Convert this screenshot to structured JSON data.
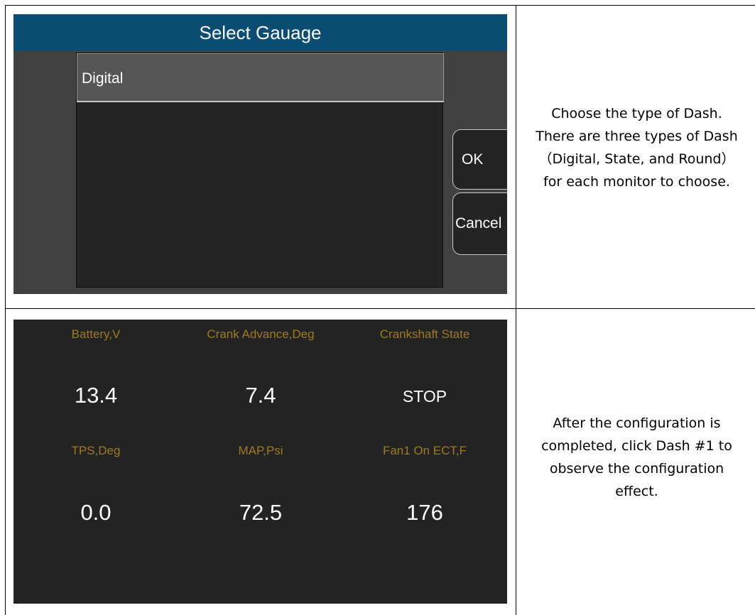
{
  "dialog": {
    "title": "Select Gauage",
    "list_items": [
      "Digital"
    ],
    "ok_label": "OK",
    "cancel_label": "Cancel"
  },
  "descriptions": {
    "top": [
      "Choose the type of Dash.",
      "There are three types of Dash",
      "（Digital, State, and Round）",
      "for each monitor to choose."
    ],
    "bottom": [
      "After the configuration is",
      "completed, click Dash #1 to",
      "observe the configuration",
      "effect."
    ]
  },
  "dash": {
    "gauges": [
      {
        "label": "Battery,V",
        "value": "13.4"
      },
      {
        "label": "Crank Advance,Deg",
        "value": "7.4"
      },
      {
        "label": "Crankshaft State",
        "value": "STOP"
      },
      {
        "label": "TPS,Deg",
        "value": "0.0"
      },
      {
        "label": "MAP,Psi",
        "value": "72.5"
      },
      {
        "label": "Fan1 On ECT,F",
        "value": "176"
      }
    ]
  },
  "colors": {
    "title_bar": "#0b4c72",
    "dialog_bg": "#414141",
    "dash_bg": "#232323",
    "gauge_label": "#a07a1e",
    "gauge_value": "#ffffff"
  }
}
